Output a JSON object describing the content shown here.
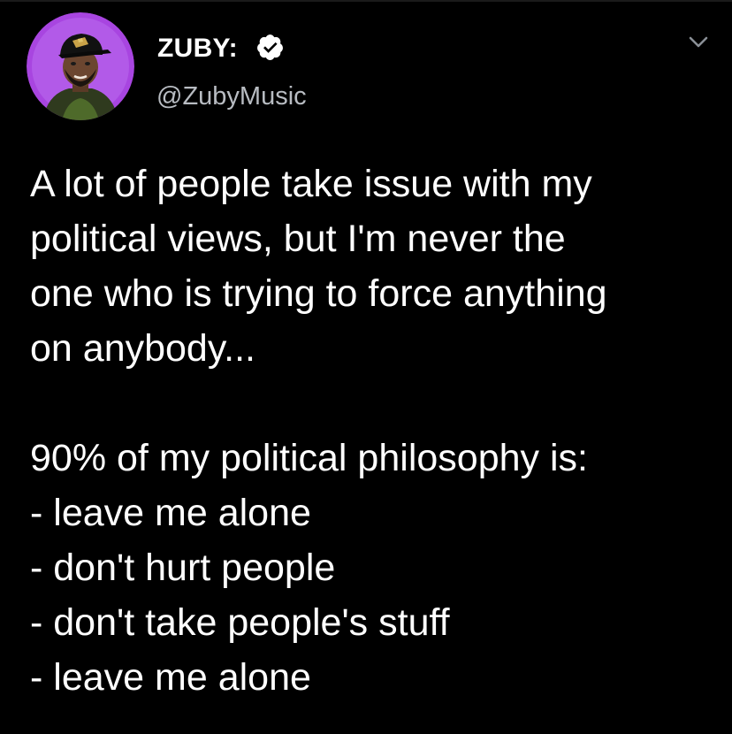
{
  "tweet": {
    "author": {
      "display_name": "ZUBY:",
      "handle": "@ZubyMusic",
      "verified": true,
      "avatar_ring_color": "#a845e0"
    },
    "menu_icon": "chevron-down-icon",
    "body": {
      "paragraph_1": [
        "A lot of people take issue with my",
        "political views, but I'm never the",
        "one who is trying to force anything",
        "on anybody..."
      ],
      "paragraph_2": [
        "90% of my political philosophy is:",
        "- leave me alone",
        "- don't hurt people",
        "- don't take people's stuff",
        "- leave me alone"
      ]
    }
  }
}
